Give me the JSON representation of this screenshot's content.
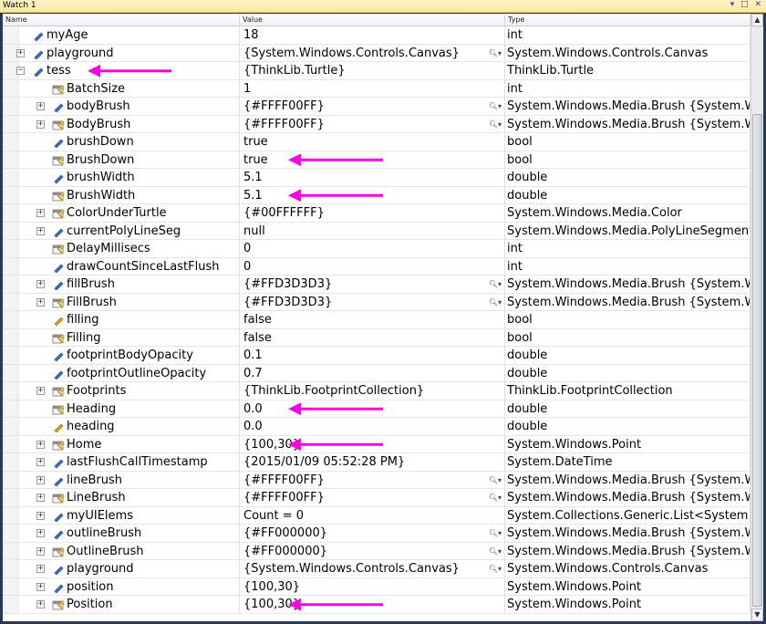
{
  "window": {
    "title": "Watch 1",
    "controls": "▾ □ ✕"
  },
  "columns": {
    "name": "Name",
    "value": "Value",
    "type": "Type"
  },
  "colors": {
    "arrow": "#ff00e6",
    "title_bg": "#fff3c4"
  },
  "rows": [
    {
      "level": 1,
      "expand": "",
      "icon": "field-icon",
      "name": "myAge",
      "value": "18",
      "mag": false,
      "type": "int"
    },
    {
      "level": 1,
      "expand": "+",
      "icon": "field-icon",
      "name": "playground",
      "value": "{System.Windows.Controls.Canvas}",
      "mag": true,
      "type": "System.Windows.Controls.Canvas"
    },
    {
      "level": 1,
      "expand": "−",
      "icon": "field-icon",
      "name": "tess",
      "value": "{ThinkLib.Turtle}",
      "mag": false,
      "type": "ThinkLib.Turtle"
    },
    {
      "level": 2,
      "expand": "",
      "icon": "property-icon",
      "name": "BatchSize",
      "value": "1",
      "mag": false,
      "type": "int"
    },
    {
      "level": 2,
      "expand": "+",
      "icon": "field-icon",
      "name": "bodyBrush",
      "value": "{#FFFF00FF}",
      "mag": true,
      "type": "System.Windows.Media.Brush {System.Win"
    },
    {
      "level": 2,
      "expand": "+",
      "icon": "property-icon",
      "name": "BodyBrush",
      "value": "{#FFFF00FF}",
      "mag": true,
      "type": "System.Windows.Media.Brush {System.Win"
    },
    {
      "level": 2,
      "expand": "",
      "icon": "field-icon",
      "name": "brushDown",
      "value": "true",
      "mag": false,
      "type": "bool"
    },
    {
      "level": 2,
      "expand": "",
      "icon": "property-icon",
      "name": "BrushDown",
      "value": "true",
      "mag": false,
      "type": "bool"
    },
    {
      "level": 2,
      "expand": "",
      "icon": "field-icon",
      "name": "brushWidth",
      "value": "5.1",
      "mag": false,
      "type": "double"
    },
    {
      "level": 2,
      "expand": "",
      "icon": "property-icon",
      "name": "BrushWidth",
      "value": "5.1",
      "mag": false,
      "type": "double"
    },
    {
      "level": 2,
      "expand": "+",
      "icon": "property-icon",
      "name": "ColorUnderTurtle",
      "value": "{#00FFFFFF}",
      "mag": false,
      "type": "System.Windows.Media.Color"
    },
    {
      "level": 2,
      "expand": "+",
      "icon": "field-icon",
      "name": "currentPolyLineSeg",
      "value": "null",
      "mag": false,
      "type": "System.Windows.Media.PolyLineSegment"
    },
    {
      "level": 2,
      "expand": "",
      "icon": "property-icon",
      "name": "DelayMillisecs",
      "value": "0",
      "mag": false,
      "type": "int"
    },
    {
      "level": 2,
      "expand": "",
      "icon": "field-icon",
      "name": "drawCountSinceLastFlush",
      "value": "0",
      "mag": false,
      "type": "int"
    },
    {
      "level": 2,
      "expand": "+",
      "icon": "field-icon",
      "name": "fillBrush",
      "value": "{#FFD3D3D3}",
      "mag": true,
      "type": "System.Windows.Media.Brush {System.Win"
    },
    {
      "level": 2,
      "expand": "+",
      "icon": "property-icon",
      "name": "FillBrush",
      "value": "{#FFD3D3D3}",
      "mag": true,
      "type": "System.Windows.Media.Brush {System.Win"
    },
    {
      "level": 2,
      "expand": "",
      "icon": "field-icon-gold",
      "name": "filling",
      "value": "false",
      "mag": false,
      "type": "bool"
    },
    {
      "level": 2,
      "expand": "",
      "icon": "property-icon",
      "name": "Filling",
      "value": "false",
      "mag": false,
      "type": "bool"
    },
    {
      "level": 2,
      "expand": "",
      "icon": "field-icon",
      "name": "footprintBodyOpacity",
      "value": "0.1",
      "mag": false,
      "type": "double"
    },
    {
      "level": 2,
      "expand": "",
      "icon": "field-icon",
      "name": "footprintOutlineOpacity",
      "value": "0.7",
      "mag": false,
      "type": "double"
    },
    {
      "level": 2,
      "expand": "+",
      "icon": "property-icon",
      "name": "Footprints",
      "value": "{ThinkLib.FootprintCollection}",
      "mag": false,
      "type": "ThinkLib.FootprintCollection"
    },
    {
      "level": 2,
      "expand": "",
      "icon": "property-icon",
      "name": "Heading",
      "value": "0.0",
      "mag": false,
      "type": "double"
    },
    {
      "level": 2,
      "expand": "",
      "icon": "field-icon-gold",
      "name": "heading",
      "value": "0.0",
      "mag": false,
      "type": "double"
    },
    {
      "level": 2,
      "expand": "+",
      "icon": "property-icon",
      "name": "Home",
      "value": "{100,30}",
      "mag": false,
      "type": "System.Windows.Point"
    },
    {
      "level": 2,
      "expand": "+",
      "icon": "field-icon",
      "name": "lastFlushCallTimestamp",
      "value": "{2015/01/09 05:52:28 PM}",
      "mag": false,
      "type": "System.DateTime"
    },
    {
      "level": 2,
      "expand": "+",
      "icon": "field-icon",
      "name": "lineBrush",
      "value": "{#FFFF00FF}",
      "mag": true,
      "type": "System.Windows.Media.Brush {System.Win"
    },
    {
      "level": 2,
      "expand": "+",
      "icon": "property-icon",
      "name": "LineBrush",
      "value": "{#FFFF00FF}",
      "mag": true,
      "type": "System.Windows.Media.Brush {System.Win"
    },
    {
      "level": 2,
      "expand": "+",
      "icon": "field-icon",
      "name": "myUIElems",
      "value": "Count = 0",
      "mag": false,
      "type": "System.Collections.Generic.List<System.Wi"
    },
    {
      "level": 2,
      "expand": "+",
      "icon": "field-icon",
      "name": "outlineBrush",
      "value": "{#FF000000}",
      "mag": true,
      "type": "System.Windows.Media.Brush {System.Win"
    },
    {
      "level": 2,
      "expand": "+",
      "icon": "property-icon",
      "name": "OutlineBrush",
      "value": "{#FF000000}",
      "mag": true,
      "type": "System.Windows.Media.Brush {System.Win"
    },
    {
      "level": 2,
      "expand": "+",
      "icon": "field-icon",
      "name": "playground",
      "value": "{System.Windows.Controls.Canvas}",
      "mag": true,
      "type": "System.Windows.Controls.Canvas"
    },
    {
      "level": 2,
      "expand": "+",
      "icon": "field-icon",
      "name": "position",
      "value": "{100,30}",
      "mag": false,
      "type": "System.Windows.Point"
    },
    {
      "level": 2,
      "expand": "+",
      "icon": "property-icon",
      "name": "Position",
      "value": "{100,30}",
      "mag": false,
      "type": "System.Windows.Point"
    }
  ],
  "annotations": [
    {
      "row": 2,
      "column": "name"
    },
    {
      "row": 7,
      "column": "value"
    },
    {
      "row": 9,
      "column": "value"
    },
    {
      "row": 21,
      "column": "value"
    },
    {
      "row": 23,
      "column": "value"
    },
    {
      "row": 32,
      "column": "value"
    }
  ]
}
